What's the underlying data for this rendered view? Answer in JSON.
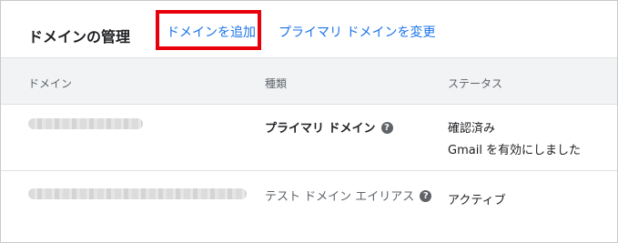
{
  "header": {
    "title": "ドメインの管理",
    "add_domain": "ドメインを追加",
    "change_primary": "プライマリ ドメインを変更",
    "highlight_color": "#e8000b"
  },
  "table": {
    "columns": [
      "ドメイン",
      "種類",
      "ステータス"
    ],
    "rows": [
      {
        "type": "プライマリ ドメイン",
        "status_line1": "確認済み",
        "status_line2": "Gmail を有効にしました"
      },
      {
        "type": "テスト ドメイン エイリアス",
        "status_line1": "アクティブ"
      }
    ]
  },
  "icons": {
    "help": "?"
  },
  "colors": {
    "link": "#1a73e8",
    "header_bg": "#f1f3f4"
  }
}
